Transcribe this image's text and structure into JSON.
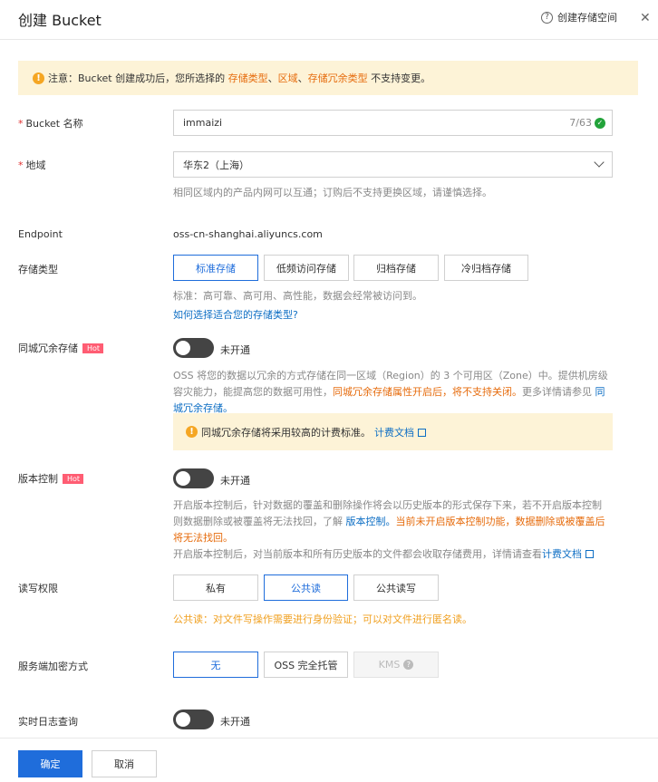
{
  "header": {
    "title": "创建 Bucket",
    "help_label": "创建存储空间",
    "close_glyph": "✕"
  },
  "notice": {
    "prefix": "注意：Bucket 创建成功后，您所选择的 ",
    "hl1": "存储类型",
    "sep1": "、",
    "hl2": "区域",
    "sep2": "、",
    "hl3": "存储冗余类型",
    "suffix": " 不支持变更。"
  },
  "bucket_name": {
    "label": "Bucket 名称",
    "value": "immaizi",
    "counter": "7/63"
  },
  "region": {
    "label": "地域",
    "value": "华东2（上海）",
    "help": "相同区域内的产品内网可以互通；订购后不支持更换区域，请谨慎选择。"
  },
  "endpoint": {
    "label": "Endpoint",
    "value": "oss-cn-shanghai.aliyuncs.com"
  },
  "storage_class": {
    "label": "存储类型",
    "options": [
      "标准存储",
      "低频访问存储",
      "归档存储",
      "冷归档存储"
    ],
    "selected": "标准存储",
    "help": "标准：高可靠、高可用、高性能，数据会经常被访问到。",
    "link": "如何选择适合您的存储类型?"
  },
  "zrs": {
    "label": "同城冗余存储",
    "badge": "Hot",
    "state": "未开通",
    "desc_line1": "OSS 将您的数据以冗余的方式存储在同一区域（Region）的 3 个可用区（Zone）中。提供机房级",
    "desc_line2a": "容灾能力，能提高您的数据可用性，",
    "desc_line2b": "同城冗余存储属性开启后，将不支持关闭。",
    "desc_line2c": "更多详情请参见 ",
    "desc_line2d": "同",
    "desc_line3": "城冗余存储。",
    "tip": "同城冗余存储将采用较高的计费标准。",
    "tip_link": "计费文档"
  },
  "versioning": {
    "label": "版本控制",
    "badge": "Hot",
    "state": "未开通",
    "line1": "开启版本控制后，针对数据的覆盖和删除操作将会以历史版本的形式保存下来，若不开启版本控制",
    "line2a": "则数据删除或被覆盖将无法找回，了解 ",
    "line2b": "版本控制。",
    "line2c": "当前未开启版本控制功能，数据删除或被覆盖后",
    "line3": "将无法找回。",
    "line4": "开启版本控制后，对当前版本和所有历史版本的文件都会收取存储费用，详情请查看",
    "line4_link": "计费文档"
  },
  "acl": {
    "label": "读写权限",
    "options": [
      "私有",
      "公共读",
      "公共读写"
    ],
    "selected": "公共读",
    "warning": "公共读：对文件写操作需要进行身份验证；可以对文件进行匿名读。"
  },
  "encryption": {
    "label": "服务端加密方式",
    "options": [
      "无",
      "OSS 完全托管",
      "KMS"
    ],
    "selected": "无"
  },
  "realtime_log": {
    "label": "实时日志查询",
    "state": "未开通"
  },
  "footer": {
    "confirm": "确定",
    "cancel": "取消"
  },
  "colors": {
    "primary": "#1f6ddb",
    "warning_orange": "#e66b0c",
    "notice_bg": "#fdf3d7",
    "hot_badge": "#ff5d73"
  }
}
